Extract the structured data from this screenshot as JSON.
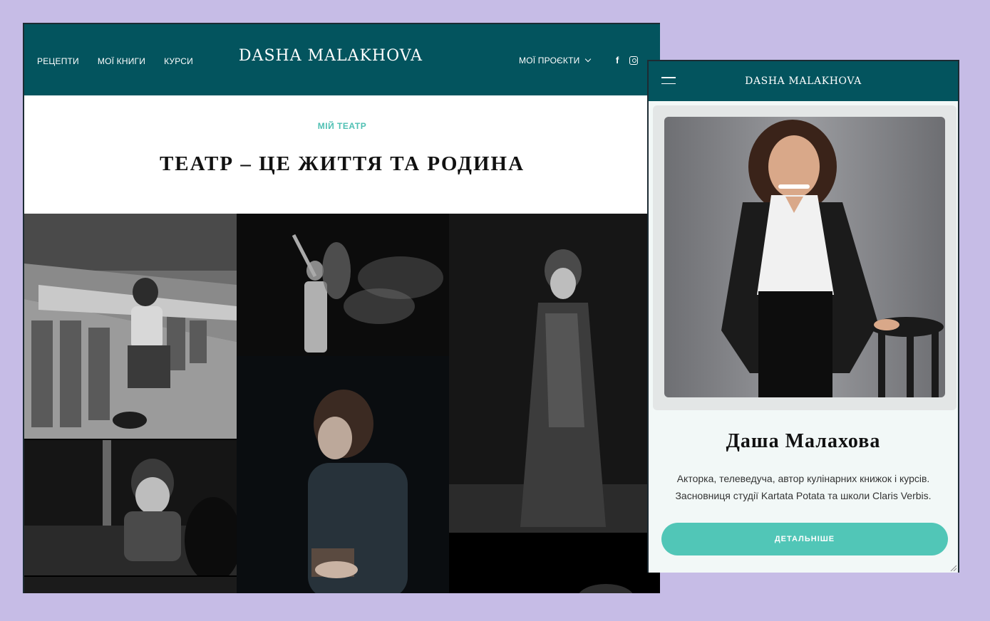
{
  "desktop": {
    "nav": [
      {
        "label": "РЕЦЕПТИ"
      },
      {
        "label": "МОЇ КНИГИ"
      },
      {
        "label": "КУРСИ"
      }
    ],
    "logo": "DASHA MALAKHOVA",
    "projects_label": "МОЇ ПРОЄКТИ",
    "social": {
      "facebook": "f",
      "instagram_icon": "instagram-icon"
    },
    "kicker": "МІЙ ТЕАТР",
    "title": "ТЕАТР – ЦЕ ЖИТТЯ ТА РОДИНА",
    "gallery_photo_count": 7
  },
  "mobile": {
    "logo": "DASHA MALAKHOVA",
    "name": "Даша Малахова",
    "description_line1": "Акторка, телеведуча, автор кулінарних книжок і курсів.",
    "description_line2": "Засновниця студії Kartata Potata та школи Claris Verbis.",
    "button_label": "ДЕТАЛЬНІШЕ"
  },
  "colors": {
    "page_background": "#c6bce6",
    "header": "#03545e",
    "accent": "#4fc0b3",
    "button": "#51c6b7"
  }
}
